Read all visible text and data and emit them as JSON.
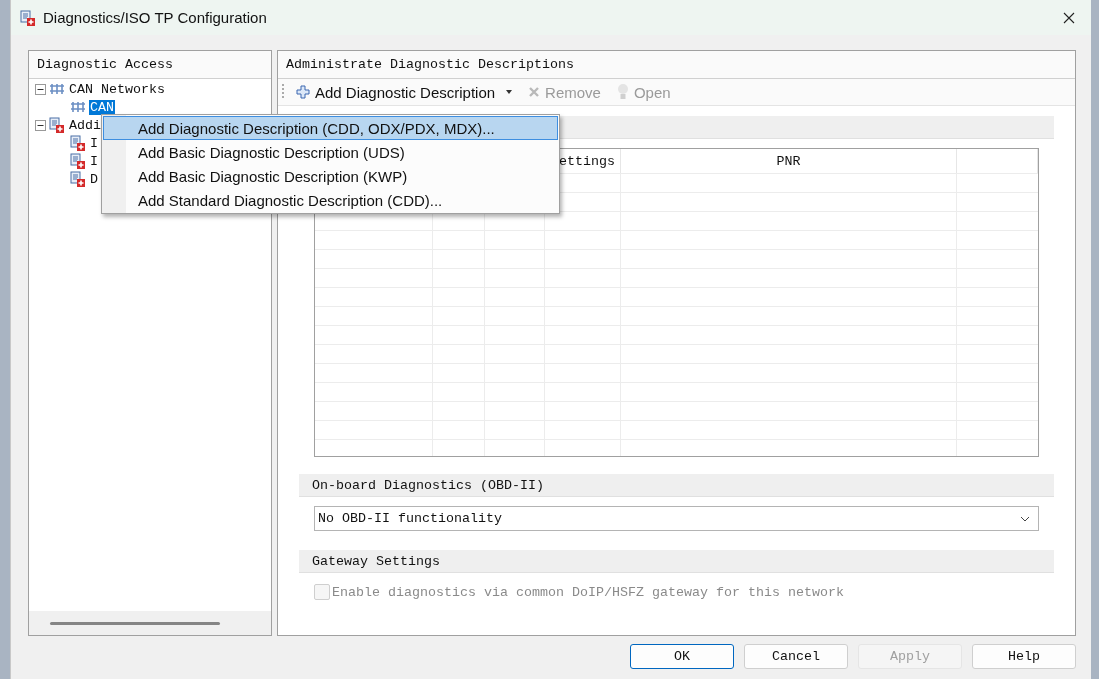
{
  "window": {
    "title": "Diagnostics/ISO TP Configuration"
  },
  "left_panel": {
    "title": "Diagnostic Access",
    "tree": [
      {
        "label": "CAN Networks",
        "kind": "network",
        "expanded": true,
        "selected": false,
        "children": [
          {
            "label": "CAN",
            "kind": "network",
            "selected": true
          }
        ]
      },
      {
        "label": "Addi",
        "kind": "document",
        "expanded": true,
        "selected": false,
        "children": [
          {
            "label": "I",
            "kind": "document",
            "selected": false
          },
          {
            "label": "I",
            "kind": "document",
            "selected": false
          },
          {
            "label": "D",
            "kind": "document",
            "selected": false
          }
        ]
      }
    ]
  },
  "right_panel": {
    "title": "Administrate Diagnostic Descriptions",
    "toolbar": [
      {
        "label": "Add Diagnostic Description",
        "kind": "add",
        "dropdown": true,
        "disabled": false
      },
      {
        "label": "Remove",
        "kind": "remove",
        "dropdown": false,
        "disabled": true
      },
      {
        "label": "Open",
        "kind": "open",
        "dropdown": false,
        "disabled": true
      }
    ],
    "table": {
      "columns": [
        "ettings",
        "PNR"
      ]
    },
    "obd": {
      "title": "On-board Diagnostics (OBD-II)",
      "value": "No OBD-II functionality"
    },
    "gateway": {
      "title": "Gateway Settings",
      "checkbox": {
        "label": "Enable diagnostics via common DoIP/HSFZ gateway for this network",
        "checked": false,
        "disabled": true
      }
    }
  },
  "context_menu": [
    {
      "label": "Add Diagnostic Description (CDD, ODX/PDX, MDX)...",
      "selected": true
    },
    {
      "label": "Add Basic Diagnostic Description (UDS)",
      "selected": false
    },
    {
      "label": "Add Basic Diagnostic Description (KWP)",
      "selected": false
    },
    {
      "label": "Add Standard Diagnostic Description (CDD)...",
      "selected": false
    }
  ],
  "buttons": [
    {
      "label": "OK",
      "kind": "default",
      "disabled": false
    },
    {
      "label": "Cancel",
      "kind": "normal",
      "disabled": false
    },
    {
      "label": "Apply",
      "kind": "normal",
      "disabled": true
    },
    {
      "label": "Help",
      "kind": "normal",
      "disabled": false
    }
  ]
}
